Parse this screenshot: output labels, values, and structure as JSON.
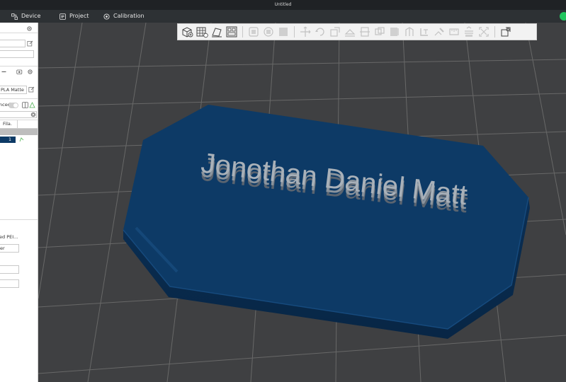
{
  "window": {
    "title": "Untitled"
  },
  "tabs": [
    {
      "label": "Device",
      "icon": "device-icon"
    },
    {
      "label": "Project",
      "icon": "project-icon"
    },
    {
      "label": "Calibration",
      "icon": "calibration-icon"
    }
  ],
  "left_panel": {
    "filament_label": "PLA Matte",
    "advanced_label": "nced",
    "table_header": "Fila.",
    "table_row_value": "1",
    "plate_type": "ed PEI...",
    "plate_sub": "er"
  },
  "model": {
    "text": "Jonothan Daniel Matt",
    "color": "#0d3a66"
  },
  "colors": {
    "accent_green": "#22c55e",
    "viewport_bg": "#3f4042",
    "grid": "#6a6a6a"
  }
}
